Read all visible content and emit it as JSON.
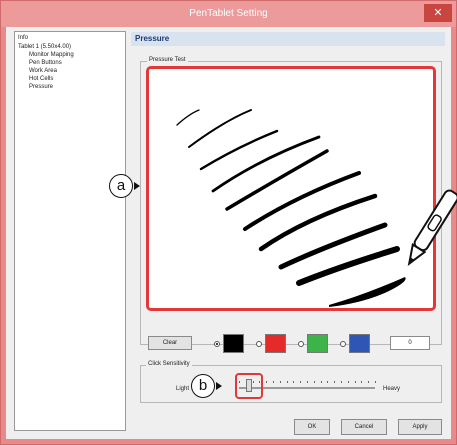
{
  "window": {
    "title": "PenTablet Setting",
    "close_glyph": "✕"
  },
  "sidebar": {
    "items": [
      {
        "label": "Info"
      },
      {
        "label": "Tablet 1 (5.50x4.00)"
      },
      {
        "label": "Monitor Mapping"
      },
      {
        "label": "Pen Buttons"
      },
      {
        "label": "Work Area"
      },
      {
        "label": "Hot Cells"
      },
      {
        "label": "Pressure"
      }
    ]
  },
  "panel": {
    "title": "Pressure"
  },
  "pressure_test": {
    "group_label": "Pressure Test"
  },
  "controls": {
    "clear_label": "Clear",
    "colors": [
      {
        "name": "black",
        "hex": "#000000",
        "selected": true
      },
      {
        "name": "red",
        "hex": "#e52a2a",
        "selected": false
      },
      {
        "name": "green",
        "hex": "#3cb449",
        "selected": false
      },
      {
        "name": "blue",
        "hex": "#2f56b4",
        "selected": false
      }
    ],
    "value": "0"
  },
  "sensitivity": {
    "group_label": "Click Sensitivity",
    "min_label": "Light",
    "max_label": "Heavy",
    "level": 0.07
  },
  "callouts": {
    "a": "a",
    "b": "b"
  },
  "footer": {
    "ok_label": "OK",
    "cancel_label": "Cancel",
    "apply_label": "Apply"
  },
  "highlight_color": "#e2383a"
}
